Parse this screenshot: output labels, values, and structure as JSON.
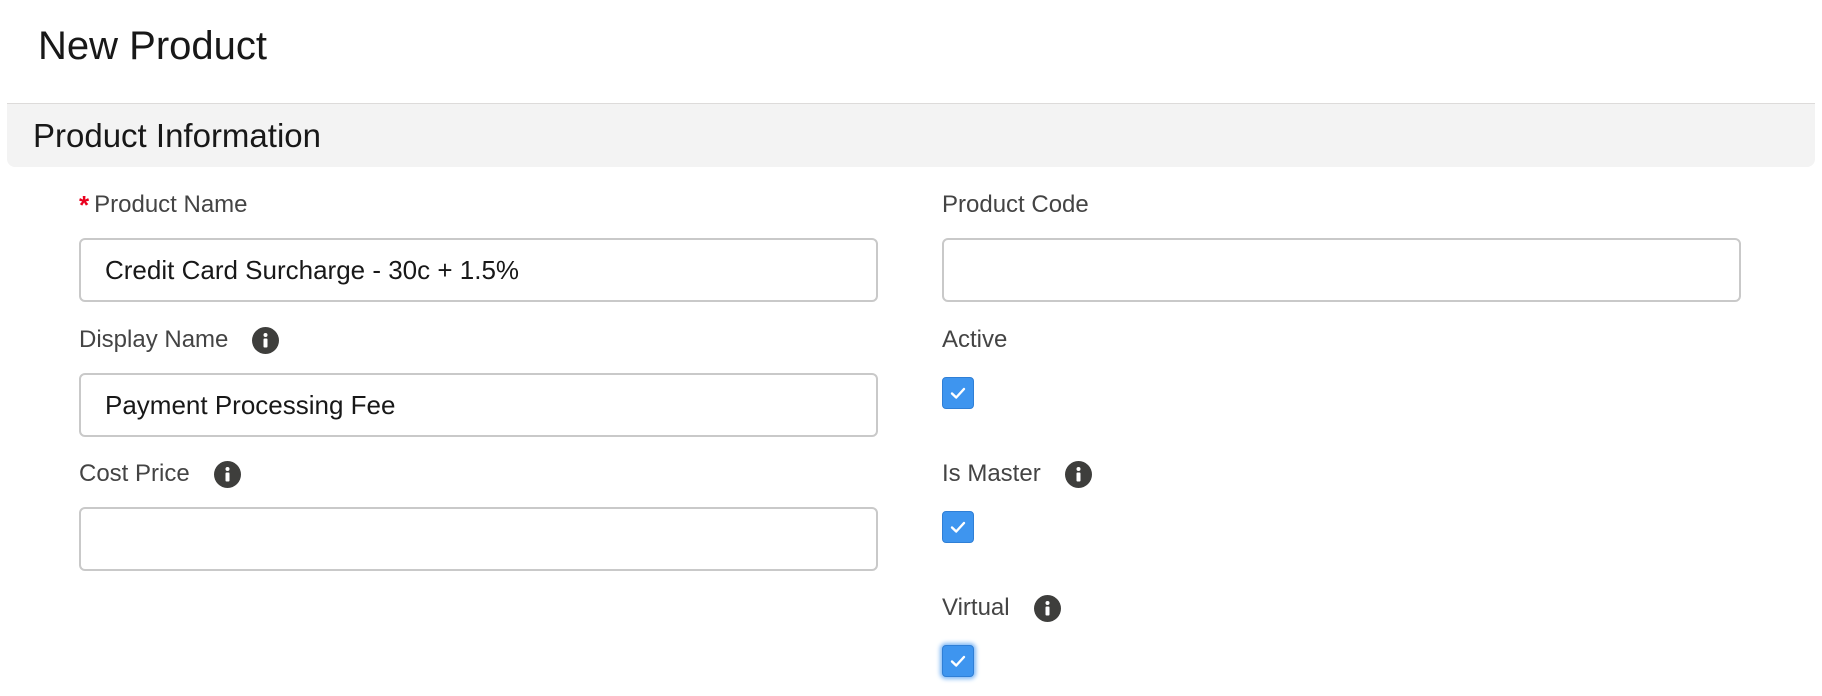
{
  "page": {
    "title": "New Product"
  },
  "section": {
    "title": "Product Information"
  },
  "fields": {
    "product_name": {
      "label": "Product Name",
      "required_marker": "*",
      "value": "Credit Card Surcharge - 30c + 1.5%"
    },
    "product_code": {
      "label": "Product Code",
      "value": ""
    },
    "display_name": {
      "label": "Display Name",
      "value": "Payment Processing Fee",
      "info_icon": "info-icon"
    },
    "cost_price": {
      "label": "Cost Price",
      "value": "",
      "info_icon": "info-icon"
    },
    "active": {
      "label": "Active",
      "checked": true
    },
    "is_master": {
      "label": "Is Master",
      "checked": true,
      "info_icon": "info-icon"
    },
    "virtual": {
      "label": "Virtual",
      "checked": true,
      "info_icon": "info-icon"
    }
  },
  "colors": {
    "checkbox_fill": "#3e95ef",
    "required_marker": "#ea001e",
    "info_icon": "#3e3e3c",
    "section_bg": "#f3f3f3"
  }
}
